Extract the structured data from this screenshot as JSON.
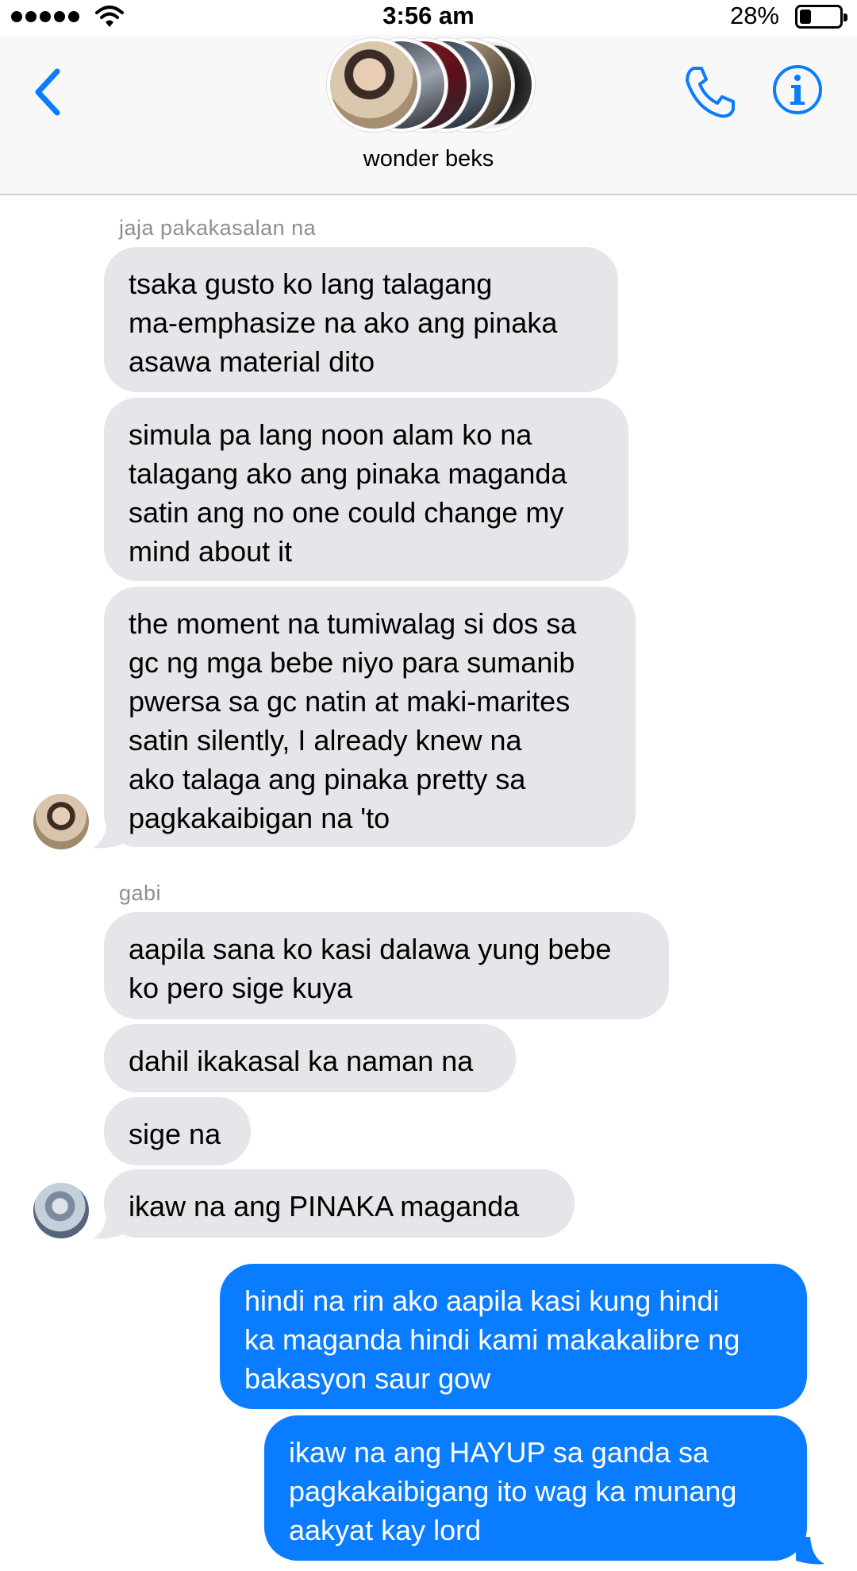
{
  "status_bar": {
    "time": "3:56 am",
    "battery_percent": "28%",
    "battery_level": 0.28,
    "signal_icon": "signal-dots-icon",
    "wifi_icon": "wifi-icon"
  },
  "header": {
    "group_name": "wonder beks",
    "back_icon": "chevron-left-icon",
    "call_icon": "phone-icon",
    "info_icon": "info-icon"
  },
  "colors": {
    "accent": "#0a7cff",
    "incoming_bubble": "#e5e5ea",
    "sender_label": "#8e8e93"
  },
  "messages": {
    "group1": {
      "sender": "jaja pakakasalan na",
      "m1": "tsaka gusto ko lang talagang\nma-emphasize na ako ang pinaka\nasawa material dito",
      "m2": "simula pa lang noon alam ko na\ntalagang ako ang pinaka maganda\nsatin ang no one could change my\nmind about it",
      "m3": "the moment na tumiwalag si dos sa\ngc ng mga bebe niyo para sumanib\npwersa sa gc natin at maki-marites\nsatin silently, I already knew na\nako talaga ang pinaka pretty sa\npagkakaibigan na 'to"
    },
    "group2": {
      "sender": "gabi",
      "m1": "aapila sana ko kasi dalawa yung bebe\nko pero sige kuya",
      "m2": "dahil ikakasal ka naman na",
      "m3": "sige na",
      "m4": "ikaw na ang PINAKA maganda"
    },
    "outgoing": {
      "m1": "hindi na rin ako aapila kasi kung hindi\nka maganda hindi kami makakalibre ng\nbakasyon saur gow",
      "m2": "ikaw na ang HAYUP sa ganda sa\npagkakaibigang ito wag ka munang\naakyat kay lord"
    }
  }
}
